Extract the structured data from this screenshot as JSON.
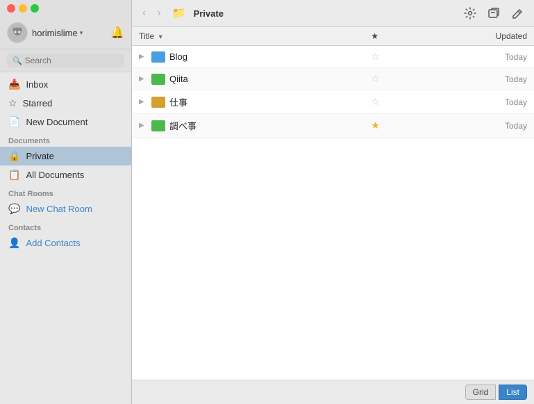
{
  "window": {
    "title": "Private"
  },
  "sidebar": {
    "user": {
      "name": "horimislime",
      "avatar_emoji": "🐱"
    },
    "search_placeholder": "Search",
    "nav_items": [
      {
        "id": "inbox",
        "label": "Inbox",
        "icon": "inbox"
      },
      {
        "id": "starred",
        "label": "Starred",
        "icon": "star"
      },
      {
        "id": "new-document",
        "label": "New Document",
        "icon": "doc-add"
      }
    ],
    "sections": [
      {
        "label": "Documents",
        "items": [
          {
            "id": "private",
            "label": "Private",
            "icon": "lock",
            "active": true
          },
          {
            "id": "all-documents",
            "label": "All Documents",
            "icon": "doc"
          }
        ]
      },
      {
        "label": "Chat Rooms",
        "items": [
          {
            "id": "new-chat-room",
            "label": "New Chat Room",
            "icon": "chat",
            "action": true
          }
        ]
      },
      {
        "label": "Contacts",
        "items": [
          {
            "id": "add-contacts",
            "label": "Add Contacts",
            "icon": "person-add",
            "action": true
          }
        ]
      }
    ]
  },
  "toolbar": {
    "back_label": "‹",
    "forward_label": "›",
    "folder_label": "Private",
    "gear_label": "⚙",
    "new_window_label": "⊞",
    "compose_label": "✎"
  },
  "table": {
    "columns": {
      "title": "Title",
      "star": "★",
      "updated": "Updated"
    },
    "rows": [
      {
        "id": 1,
        "name": "Blog",
        "color": "blue",
        "starred": false,
        "updated": "Today"
      },
      {
        "id": 2,
        "name": "Qiita",
        "color": "green",
        "starred": false,
        "updated": "Today"
      },
      {
        "id": 3,
        "name": "仕事",
        "color": "tan",
        "starred": false,
        "updated": "Today"
      },
      {
        "id": 4,
        "name": "調べ事",
        "color": "green",
        "starred": true,
        "updated": "Today"
      }
    ]
  },
  "bottom_bar": {
    "grid_label": "Grid",
    "list_label": "List",
    "active_view": "list"
  },
  "colors": {
    "accent": "#3a85c8",
    "star_filled": "#f0b429",
    "star_empty": "#cccccc"
  }
}
